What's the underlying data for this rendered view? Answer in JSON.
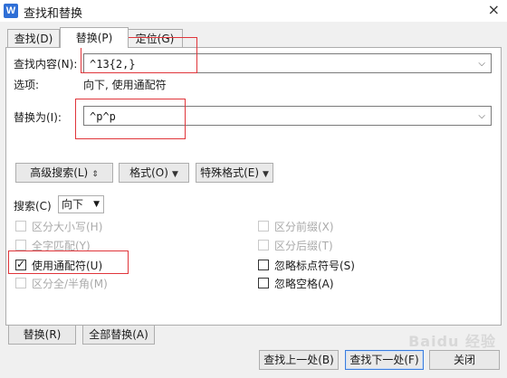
{
  "window": {
    "title": "查找和替换",
    "app_icon_letter": "W",
    "close_glyph": "×"
  },
  "tabs": [
    {
      "label": "查找(D)"
    },
    {
      "label": "替换(P)",
      "active": true
    },
    {
      "label": "定位(G)"
    }
  ],
  "find": {
    "label": "查找内容(N):",
    "value": "^13{2,}"
  },
  "options_summary": {
    "label": "选项:",
    "value": "向下, 使用通配符"
  },
  "replace": {
    "label": "替换为(I):",
    "value": "^p^p"
  },
  "toolbar": {
    "advanced": "高级搜索(L)",
    "advanced_glyph": "⇕",
    "format": "格式(O)",
    "special": "特殊格式(E)",
    "dropdown_glyph": "▼"
  },
  "search": {
    "label": "搜索(C)",
    "value": "向下"
  },
  "checkboxes_left": [
    {
      "label": "区分大小写(H)",
      "checked": false,
      "enabled": false
    },
    {
      "label": "全字匹配(Y)",
      "checked": false,
      "enabled": false
    },
    {
      "label": "使用通配符(U)",
      "checked": true,
      "enabled": true
    },
    {
      "label": "区分全/半角(M)",
      "checked": false,
      "enabled": false
    }
  ],
  "checkboxes_right": [
    {
      "label": "区分前缀(X)",
      "checked": false,
      "enabled": false
    },
    {
      "label": "区分后缀(T)",
      "checked": false,
      "enabled": false
    },
    {
      "label": "忽略标点符号(S)",
      "checked": false,
      "enabled": true
    },
    {
      "label": "忽略空格(A)",
      "checked": false,
      "enabled": true
    }
  ],
  "actions": {
    "replace": "替换(R)",
    "replace_all": "全部替换(A)",
    "find_prev": "查找上一处(B)",
    "find_next": "查找下一处(F)",
    "close": "关闭"
  },
  "watermark": "Baidu 经验",
  "colors": {
    "highlight_box": "#e0353a",
    "primary_border": "#3b7ddd"
  }
}
